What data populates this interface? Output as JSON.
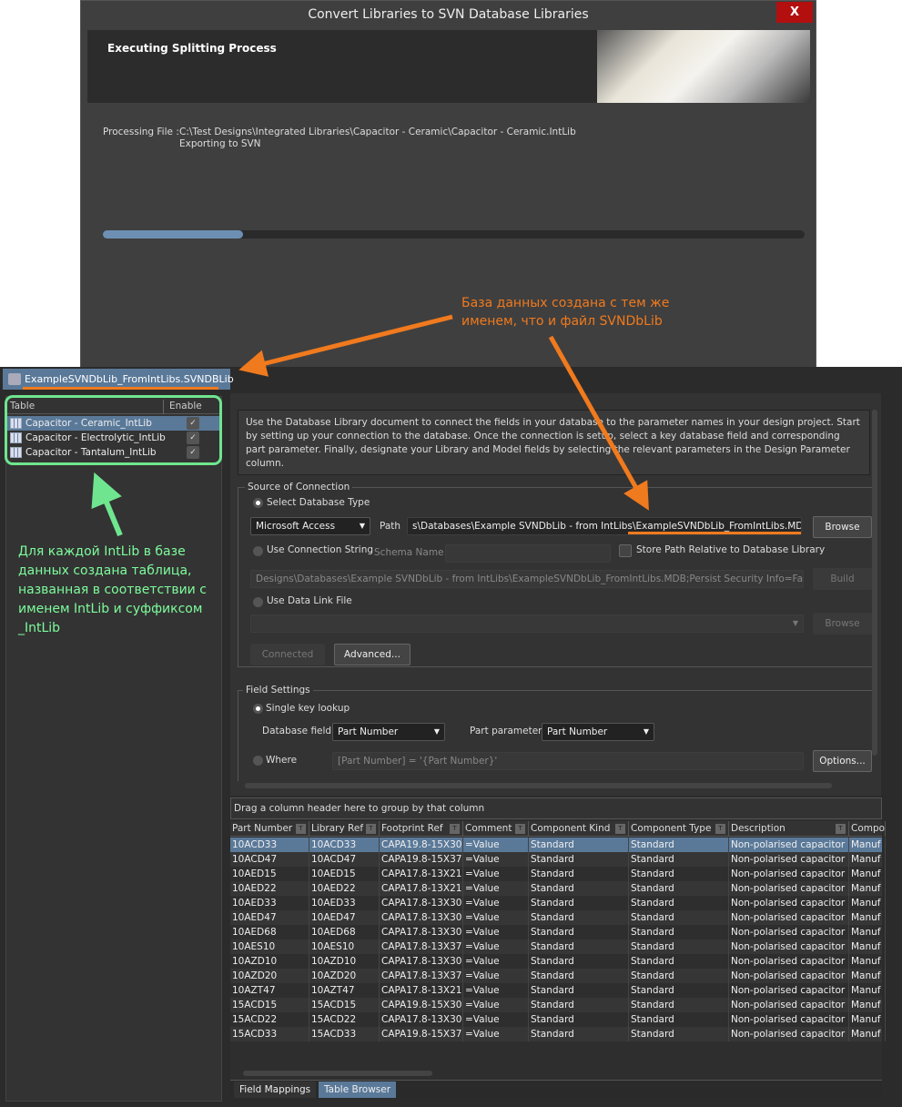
{
  "dialog": {
    "title": "Convert Libraries to SVN Database Libraries",
    "close_label": "X",
    "header_title": "Executing Splitting Process",
    "processing_label": "Processing File :",
    "processing_path": "C:\\Test Designs\\Integrated Libraries\\Capacitor - Ceramic\\Capacitor - Ceramic.IntLib",
    "status": "Exporting to SVN",
    "progress_percent": 20
  },
  "annotations": {
    "orange": [
      "База данных создана с тем же",
      "именем, что и файл SVNDbLib"
    ],
    "green": [
      "Для каждой IntLib в базе",
      "данных создана таблица,",
      "названная в соответствии с",
      "именем IntLib и суффиксом",
      "_IntLib"
    ],
    "colors": {
      "orange": "#f07a1e",
      "green": "#6fe58f"
    }
  },
  "document_tab": "ExampleSVNDbLib_FromIntLibs.SVNDBLib *",
  "tables_panel": {
    "col_table": "Table",
    "col_enable": "Enable",
    "rows": [
      {
        "name": "Capacitor - Ceramic_IntLib",
        "enabled": true
      },
      {
        "name": "Capacitor - Electrolytic_IntLib",
        "enabled": true
      },
      {
        "name": "Capacitor - Tantalum_IntLib",
        "enabled": true
      }
    ]
  },
  "info_text": "Use the Database Library document to connect the fields in your database to the parameter names in your design project. Start by setting up your connection to the database. Once the connection is setup, select a key database field and corresponding part parameter. Finally, designate your Library and Model fields by selecting the relevant parameters in the Design Parameter column.",
  "connection": {
    "group": "Source of Connection",
    "select_db_type": "Select Database Type",
    "db_type": "Microsoft Access",
    "path_label": "Path",
    "path": "s\\Databases\\Example SVNDbLib - from IntLibs\\ExampleSVNDbLib_FromIntLibs.MDB",
    "browse": "Browse",
    "use_conn_string": "Use Connection String",
    "schema_name": "Schema Name",
    "store_relative": "Store Path Relative to Database Library",
    "conn_string": "Designs\\Databases\\Example SVNDbLib - from IntLibs\\ExampleSVNDbLib_FromIntLibs.MDB;Persist Security Info=False",
    "build": "Build",
    "use_data_link": "Use Data Link File",
    "browse2": "Browse",
    "connected": "Connected",
    "advanced": "Advanced..."
  },
  "field_settings": {
    "group": "Field Settings",
    "single_key": "Single key lookup",
    "db_field_label": "Database field",
    "db_field": "Part Number",
    "part_param_label": "Part parameter",
    "part_param": "Part Number",
    "where": "Where",
    "where_value": "[Part Number] = '{Part Number}'",
    "options": "Options..."
  },
  "grid": {
    "group_hint": "Drag a column header here to group by that column",
    "columns": [
      "Part Number",
      "Library Ref",
      "Footprint Ref",
      "Comment",
      "Component Kind",
      "Component Type",
      "Description",
      "Compo"
    ],
    "rows": [
      [
        "10ACD33",
        "10ACD33",
        "CAPA19.8-15X30",
        "=Value",
        "Standard",
        "Standard",
        "Non-polarised capacitor",
        "Manuf"
      ],
      [
        "10ACD47",
        "10ACD47",
        "CAPA19.8-15X37",
        "=Value",
        "Standard",
        "Standard",
        "Non-polarised capacitor",
        "Manuf"
      ],
      [
        "10AED15",
        "10AED15",
        "CAPA17.8-13X21",
        "=Value",
        "Standard",
        "Standard",
        "Non-polarised capacitor",
        "Manuf"
      ],
      [
        "10AED22",
        "10AED22",
        "CAPA17.8-13X21",
        "=Value",
        "Standard",
        "Standard",
        "Non-polarised capacitor",
        "Manuf"
      ],
      [
        "10AED33",
        "10AED33",
        "CAPA17.8-13X30",
        "=Value",
        "Standard",
        "Standard",
        "Non-polarised capacitor",
        "Manuf"
      ],
      [
        "10AED47",
        "10AED47",
        "CAPA17.8-13X30",
        "=Value",
        "Standard",
        "Standard",
        "Non-polarised capacitor",
        "Manuf"
      ],
      [
        "10AED68",
        "10AED68",
        "CAPA17.8-13X30",
        "=Value",
        "Standard",
        "Standard",
        "Non-polarised capacitor",
        "Manuf"
      ],
      [
        "10AES10",
        "10AES10",
        "CAPA17.8-13X37",
        "=Value",
        "Standard",
        "Standard",
        "Non-polarised capacitor",
        "Manuf"
      ],
      [
        "10AZD10",
        "10AZD10",
        "CAPA17.8-13X30",
        "=Value",
        "Standard",
        "Standard",
        "Non-polarised capacitor",
        "Manuf"
      ],
      [
        "10AZD20",
        "10AZD20",
        "CAPA17.8-13X37",
        "=Value",
        "Standard",
        "Standard",
        "Non-polarised capacitor",
        "Manuf"
      ],
      [
        "10AZT47",
        "10AZT47",
        "CAPA17.8-13X21",
        "=Value",
        "Standard",
        "Standard",
        "Non-polarised capacitor",
        "Manuf"
      ],
      [
        "15ACD15",
        "15ACD15",
        "CAPA19.8-15X30",
        "=Value",
        "Standard",
        "Standard",
        "Non-polarised capacitor",
        "Manuf"
      ],
      [
        "15ACD22",
        "15ACD22",
        "CAPA17.8-13X30",
        "=Value",
        "Standard",
        "Standard",
        "Non-polarised capacitor",
        "Manuf"
      ],
      [
        "15ACD33",
        "15ACD33",
        "CAPA19.8-15X37",
        "=Value",
        "Standard",
        "Standard",
        "Non-polarised capacitor",
        "Manuf"
      ]
    ]
  },
  "bottom_tabs": [
    "Field Mappings",
    "Table Browser"
  ]
}
